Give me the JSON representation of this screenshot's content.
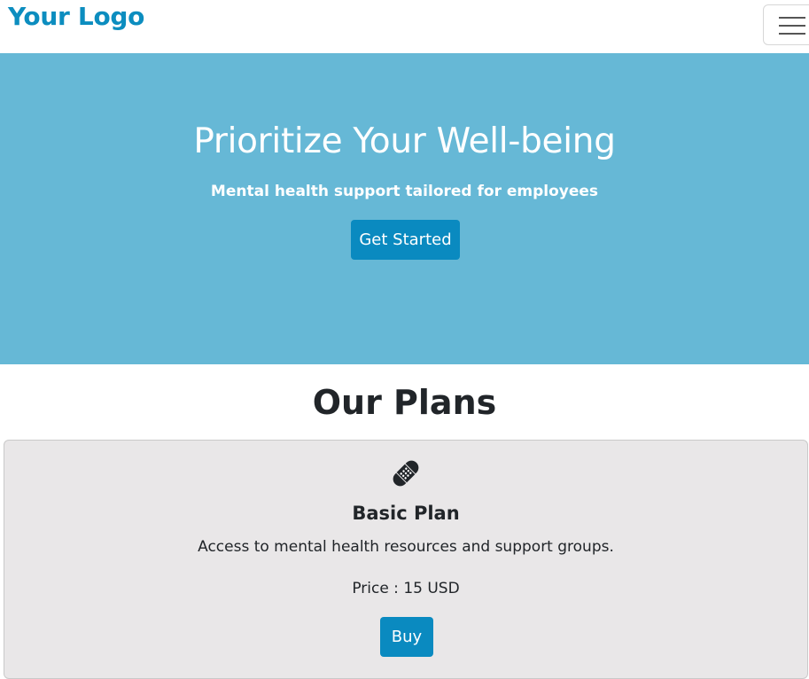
{
  "navbar": {
    "logo": "Your Logo",
    "menu_icon": "hamburger-menu-icon"
  },
  "hero": {
    "title": "Prioritize Your Well-being",
    "subtitle": "Mental health support tailored for employees",
    "cta_label": "Get Started"
  },
  "plans": {
    "title": "Our Plans",
    "items": [
      {
        "icon": "bandage-icon",
        "name": "Basic Plan",
        "description": "Access to mental health resources and support groups.",
        "price": "Price : 15 USD",
        "buy_label": "Buy"
      }
    ]
  },
  "colors": {
    "brand": "#0c8dbf",
    "hero_bg": "#66b8d6",
    "button_bg": "#0a8ac0",
    "card_bg": "#e9e7e8"
  }
}
